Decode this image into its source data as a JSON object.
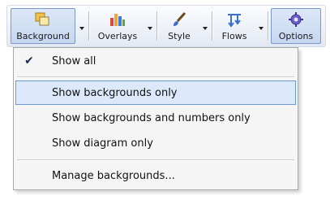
{
  "toolbar": {
    "buttons": [
      {
        "label": "Background",
        "icon": "background-icon",
        "pressed": true
      },
      {
        "label": "Overlays",
        "icon": "overlays-icon",
        "pressed": false
      },
      {
        "label": "Style",
        "icon": "style-brush-icon",
        "pressed": false
      },
      {
        "label": "Flows",
        "icon": "flows-icon",
        "pressed": false
      },
      {
        "label": "Options",
        "icon": "gear-icon",
        "pressed": true
      }
    ]
  },
  "menu": {
    "items": [
      {
        "label": "Show all",
        "checked": true,
        "highlighted": false
      },
      {
        "label": "Show backgrounds only",
        "checked": false,
        "highlighted": true
      },
      {
        "label": "Show backgrounds and numbers only",
        "checked": false,
        "highlighted": false
      },
      {
        "label": "Show diagram only",
        "checked": false,
        "highlighted": false
      },
      {
        "label": "Manage backgrounds...",
        "checked": false,
        "highlighted": false
      }
    ],
    "check_glyph": "✔"
  },
  "colors": {
    "highlight_fill": "#dce9fa",
    "highlight_border": "#6f97d2",
    "menu_bg": "#f5f5f5"
  }
}
